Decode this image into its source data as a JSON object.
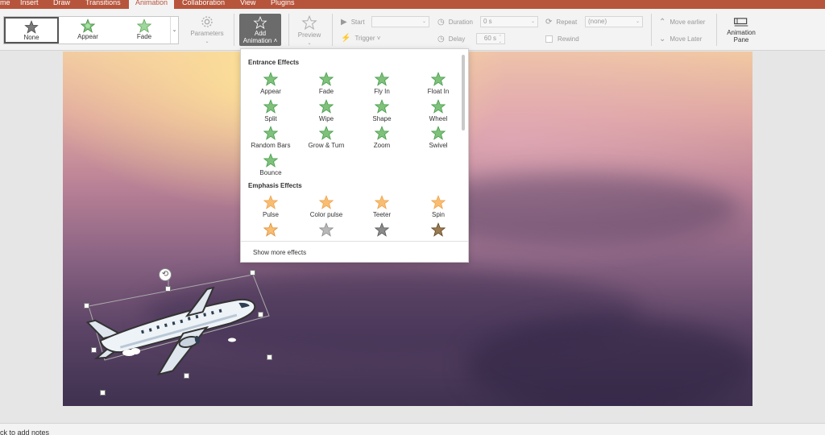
{
  "menu_tabs": [
    {
      "label": "me",
      "active": false
    },
    {
      "label": "Insert",
      "active": false
    },
    {
      "label": "Draw",
      "active": false
    },
    {
      "label": "Transitions",
      "active": false
    },
    {
      "label": "Animation",
      "active": true
    },
    {
      "label": "Collaboration",
      "active": false
    },
    {
      "label": "View",
      "active": false
    },
    {
      "label": "Plugins",
      "active": false
    }
  ],
  "gallery": {
    "items": [
      {
        "label": "None",
        "icon": "star-none-icon",
        "selected": true
      },
      {
        "label": "Appear",
        "icon": "star-appear-icon",
        "selected": false
      },
      {
        "label": "Fade",
        "icon": "star-fade-icon",
        "selected": false
      }
    ]
  },
  "ribbon": {
    "parameters": "Parameters",
    "add_animation_line1": "Add",
    "add_animation_line2": "Animation ˄",
    "preview": "Preview",
    "start_label": "Start",
    "start_value": "",
    "trigger_label": "Trigger ˅",
    "duration_label": "Duration",
    "duration_value": "0 s",
    "delay_label": "Delay",
    "delay_value": "60 s",
    "repeat_label": "Repeat",
    "repeat_value": "(none)",
    "rewind_label": "Rewind",
    "move_earlier": "Move earlier",
    "move_later": "Move Later",
    "animation_pane_line1": "Animation",
    "animation_pane_line2": "Pane"
  },
  "dropdown": {
    "entrance_title": "Entrance Effects",
    "entrance": [
      "Appear",
      "Fade",
      "Fly In",
      "Float In",
      "Split",
      "Wipe",
      "Shape",
      "Wheel",
      "Random Bars",
      "Grow & Turn",
      "Zoom",
      "Swivel",
      "Bounce"
    ],
    "emphasis_title": "Emphasis Effects",
    "emphasis": [
      "Pulse",
      "Color pulse",
      "Teeter",
      "Spin"
    ],
    "show_more": "Show more effects"
  },
  "notes_placeholder": "ck to add notes",
  "colors": {
    "accent": "#b7553c",
    "entrance_green": "#3f9a45",
    "emphasis_orange": "#f0a046"
  }
}
